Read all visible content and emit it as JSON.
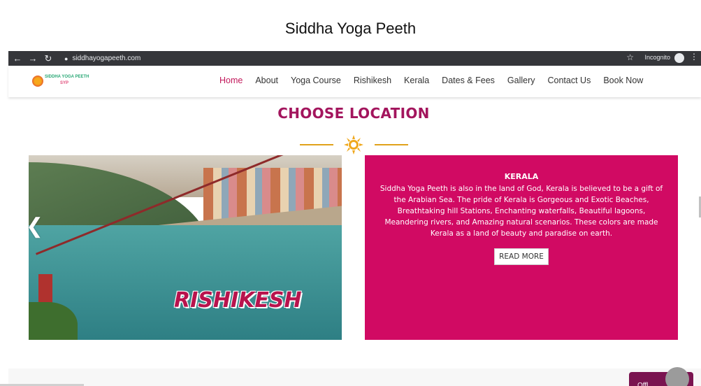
{
  "caption": "Siddha Yoga Peeth",
  "browser": {
    "url": "siddhayogapeeth.com",
    "incognito_label": "Incognito",
    "icons": [
      "back-arrow-icon",
      "forward-arrow-icon",
      "reload-icon",
      "lock-icon",
      "star-icon",
      "incognito-icon",
      "menu-dots-icon"
    ]
  },
  "site": {
    "logo_text": "SIDDHA YOGA PEETH",
    "logo_short": "SYP",
    "nav": [
      "Home",
      "About",
      "Yoga Course",
      "Rishikesh",
      "Kerala",
      "Dates & Fees",
      "Gallery",
      "Contact Us",
      "Book Now"
    ],
    "active_nav": "Home",
    "accent_color": "#c2185b"
  },
  "section": {
    "title": "CHOOSE LOCATION"
  },
  "slider": {
    "image_label": "RISHIKESH",
    "card": {
      "title": "KERALA",
      "body": "Siddha Yoga Peeth is also in the land of God, Kerala is believed to be a gift of the Arabian Sea. The pride of Kerala is Gorgeous and Exotic Beaches, Breathtaking hill Stations, Enchanting waterfalls, Beautiful lagoons, Meandering rivers, and Amazing natural scenarios. These colors are made Kerala as a land of beauty and paradise on earth.",
      "button": "READ MORE",
      "background_color": "#d10a63"
    }
  },
  "footer": {
    "chip_text": "Offl"
  }
}
